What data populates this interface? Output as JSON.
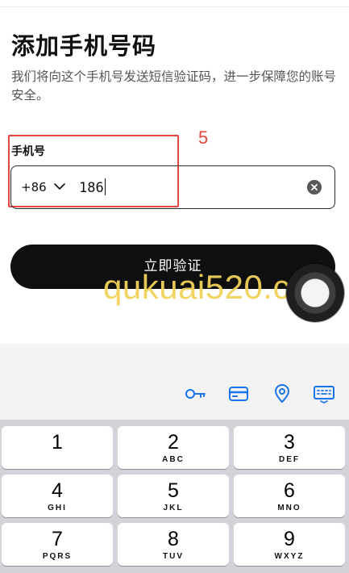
{
  "header": {
    "title": "添加手机号码",
    "subtitle": "我们将向这个手机号发送短信验证码，进一步保障您的账号安全。"
  },
  "annotation": {
    "number": "5"
  },
  "phone_form": {
    "label": "手机号",
    "country_code": "+86",
    "value": "186"
  },
  "verify_button": {
    "label": "立即验证"
  },
  "watermark": "qukuai520.com",
  "keyboard": {
    "toolbar_icons": [
      "key-icon",
      "credit-card-icon",
      "location-pin-icon",
      "keyboard-icon"
    ],
    "accent_color": "#1a73e8",
    "keys": [
      {
        "digit": "1",
        "letters": ""
      },
      {
        "digit": "2",
        "letters": "ABC"
      },
      {
        "digit": "3",
        "letters": "DEF"
      },
      {
        "digit": "4",
        "letters": "GHI"
      },
      {
        "digit": "5",
        "letters": "JKL"
      },
      {
        "digit": "6",
        "letters": "MNO"
      },
      {
        "digit": "7",
        "letters": "PQRS"
      },
      {
        "digit": "8",
        "letters": "TUV"
      },
      {
        "digit": "9",
        "letters": "WXYZ"
      }
    ]
  }
}
